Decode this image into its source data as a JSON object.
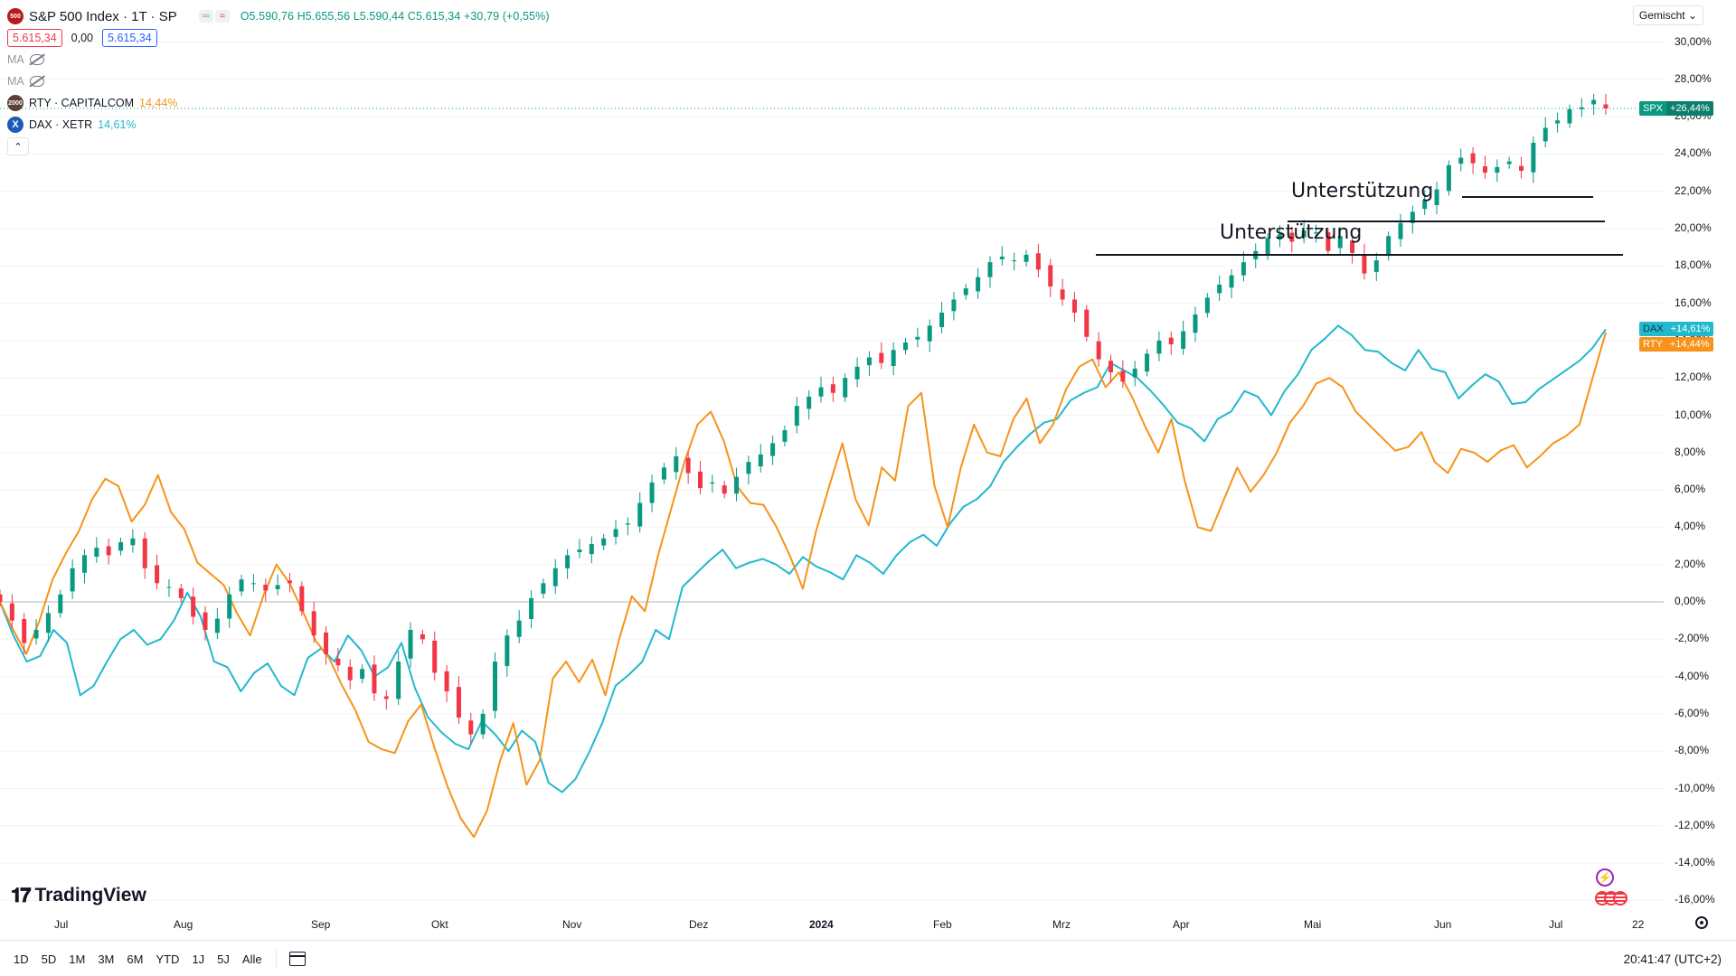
{
  "header": {
    "logo_text": "500",
    "symbol_title": "S&P 500 Index · 1T · SP",
    "ohlc": "O5.590,76 H5.655,56 L5.590,44 C5.615,34 +30,79 (+0,55%)",
    "bid": "5.615,34",
    "spread": "0,00",
    "ask": "5.615,34",
    "ma1_label": "MA",
    "ma2_label": "MA",
    "compare": [
      {
        "logo": "2000",
        "label": "RTY · CAPITALCOM",
        "value": "14,44%",
        "color": "#f7931a"
      },
      {
        "logo": "X",
        "label": "DAX · XETR",
        "value": "14,61%",
        "color": "#22b8cf"
      }
    ],
    "collapse_icon": "chevron-up-icon"
  },
  "scale_mode": "Gemischt",
  "y_axis_labels": [
    "30,00%",
    "28,00%",
    "26,00%",
    "24,00%",
    "22,00%",
    "20,00%",
    "18,00%",
    "16,00%",
    "14,00%",
    "12,00%",
    "10,00%",
    "8,00%",
    "6,00%",
    "4,00%",
    "2,00%",
    "0,00%",
    "-2,00%",
    "-4,00%",
    "-6,00%",
    "-8,00%",
    "-10,00%",
    "-12,00%",
    "-14,00%",
    "-16,00%"
  ],
  "x_axis_labels": [
    "Jul",
    "Aug",
    "Sep",
    "Okt",
    "Nov",
    "Dez",
    "2024",
    "Feb",
    "Mrz",
    "Apr",
    "Mai",
    "Jun",
    "Jul",
    "22"
  ],
  "price_tags": [
    {
      "symbol": "SPX",
      "value": "+26,44%",
      "color": "#089981"
    },
    {
      "symbol": "DAX",
      "value": "+14,61%",
      "color": "#22b8cf"
    },
    {
      "symbol": "RTY",
      "value": "+14,44%",
      "color": "#f7931a"
    }
  ],
  "annotations": [
    "Unterstützung",
    "Unterstützung"
  ],
  "colors": {
    "up": "#089981",
    "down": "#f23645",
    "rty": "#f7931a",
    "dax": "#22b8cf",
    "accent": "#2962ff"
  },
  "brand": "TradingView",
  "bottom_bar": {
    "ranges": [
      "1D",
      "5D",
      "1M",
      "3M",
      "6M",
      "YTD",
      "1J",
      "5J",
      "Alle"
    ],
    "clock": "20:41:47 (UTC+2)"
  },
  "chart_data": {
    "type": "line",
    "yunit": "%",
    "ylim": [
      -16.6,
      30.6
    ],
    "x": [
      "Jul",
      "Aug",
      "Sep",
      "Okt",
      "Nov",
      "Dez",
      "2024",
      "Feb",
      "Mrz",
      "Apr",
      "Mai",
      "Jun",
      "Jul"
    ],
    "series": [
      {
        "name": "SPX",
        "type": "candlestick",
        "values": [
          0.0,
          -1.0,
          -2.2,
          -1.5,
          -0.6,
          0.4,
          1.8,
          2.5,
          2.9,
          2.5,
          3.2,
          3.4,
          1.8,
          1.0,
          0.8,
          0.2,
          -0.8,
          -1.5,
          -0.9,
          0.4,
          1.2,
          1.0,
          0.6,
          0.9,
          1.0,
          -0.5,
          -1.8,
          -2.8,
          -3.4,
          -4.2,
          -3.6,
          -4.9,
          -5.2,
          -3.2,
          -1.5,
          -2.0,
          -3.8,
          -4.8,
          -6.2,
          -7.1,
          -6.0,
          -3.2,
          -1.8,
          -1.0,
          0.2,
          1.0,
          1.8,
          2.5,
          2.8,
          3.1,
          3.4,
          3.9,
          4.2,
          5.3,
          6.4,
          7.2,
          7.8,
          6.9,
          6.1,
          6.4,
          5.8,
          6.7,
          7.5,
          7.9,
          8.5,
          9.2,
          10.5,
          11.0,
          11.5,
          11.2,
          12.0,
          12.6,
          13.1,
          12.8,
          13.5,
          13.9,
          14.2,
          14.8,
          15.5,
          16.2,
          16.8,
          17.4,
          18.2,
          18.5,
          18.3,
          18.6,
          17.8,
          16.9,
          16.2,
          15.5,
          14.2,
          13.0,
          12.3,
          11.8,
          12.5,
          13.3,
          14.0,
          13.8,
          14.5,
          15.4,
          16.3,
          17.0,
          17.5,
          18.2,
          18.8,
          19.5,
          19.7,
          19.3,
          19.9,
          19.8,
          18.8,
          19.6,
          18.7,
          17.6,
          18.3,
          19.6,
          20.3,
          20.9,
          21.5,
          22.1,
          23.4,
          23.8,
          23.5,
          23.0,
          23.3,
          23.6,
          23.1,
          24.6,
          25.4,
          25.8,
          26.4,
          26.5,
          26.9,
          26.44
        ]
      },
      {
        "name": "RTY",
        "type": "line",
        "values": [
          0.0,
          -1.5,
          -2.8,
          -1.0,
          1.2,
          2.6,
          3.8,
          5.5,
          6.6,
          6.2,
          4.3,
          5.2,
          6.8,
          4.8,
          3.9,
          2.1,
          1.5,
          0.9,
          -0.6,
          -1.8,
          0.3,
          2.0,
          1.0,
          -0.5,
          -2.1,
          -3.0,
          -4.5,
          -5.8,
          -7.5,
          -7.9,
          -8.1,
          -6.4,
          -5.5,
          -7.8,
          -9.9,
          -11.6,
          -12.6,
          -11.2,
          -8.5,
          -6.5,
          -9.8,
          -8.5,
          -4.1,
          -3.2,
          -4.3,
          -3.1,
          -5.0,
          -2.1,
          0.3,
          -0.5,
          2.5,
          5.0,
          7.5,
          9.5,
          10.2,
          8.6,
          6.2,
          5.3,
          5.2,
          4.0,
          2.5,
          0.7,
          3.8,
          6.2,
          8.5,
          5.5,
          4.1,
          7.2,
          6.5,
          10.5,
          11.2,
          6.2,
          4.0,
          7.2,
          9.5,
          8.0,
          7.8,
          9.8,
          10.9,
          8.5,
          9.5,
          11.4,
          12.6,
          13.0,
          11.5,
          12.3,
          11.0,
          9.4,
          8.0,
          9.8,
          6.5,
          4.0,
          3.8,
          5.5,
          7.2,
          5.9,
          6.8,
          8.0,
          9.6,
          10.5,
          11.7,
          12.0,
          11.5,
          10.2,
          9.5,
          8.8,
          8.1,
          8.3,
          9.1,
          7.5,
          6.9,
          8.2,
          8.0,
          7.5,
          8.1,
          8.4,
          7.2,
          7.8,
          8.5,
          8.9,
          9.5,
          12.0,
          14.44
        ]
      },
      {
        "name": "DAX",
        "type": "line",
        "values": [
          0.0,
          -1.8,
          -3.2,
          -2.9,
          -1.5,
          -2.2,
          -5.0,
          -4.5,
          -3.2,
          -2.0,
          -1.5,
          -2.3,
          -2.0,
          -1.0,
          0.5,
          -0.8,
          -3.2,
          -3.5,
          -4.8,
          -3.8,
          -3.3,
          -4.5,
          -5.0,
          -3.0,
          -2.5,
          -3.2,
          -1.8,
          -2.6,
          -4.0,
          -3.5,
          -2.2,
          -4.6,
          -6.2,
          -7.0,
          -7.6,
          -7.9,
          -6.4,
          -7.1,
          -8.0,
          -6.9,
          -7.5,
          -9.7,
          -10.2,
          -9.5,
          -8.1,
          -6.5,
          -4.5,
          -3.9,
          -3.2,
          -1.5,
          -2.0,
          0.8,
          1.5,
          2.2,
          2.8,
          1.8,
          2.1,
          2.3,
          2.0,
          1.5,
          2.4,
          1.9,
          1.6,
          1.2,
          2.5,
          2.1,
          1.5,
          2.5,
          3.2,
          3.6,
          3.0,
          4.2,
          5.1,
          5.5,
          6.2,
          7.5,
          8.3,
          9.0,
          9.6,
          9.8,
          10.8,
          11.2,
          11.5,
          12.8,
          12.4,
          12.0,
          11.3,
          10.5,
          9.6,
          9.3,
          8.6,
          9.8,
          10.2,
          11.3,
          11.0,
          10.0,
          11.3,
          12.2,
          13.5,
          14.1,
          14.8,
          14.3,
          13.5,
          13.4,
          12.8,
          12.4,
          13.5,
          12.5,
          12.3,
          10.9,
          11.6,
          12.2,
          11.8,
          10.6,
          10.7,
          11.4,
          11.9,
          12.4,
          12.9,
          13.6,
          14.61
        ]
      }
    ]
  }
}
